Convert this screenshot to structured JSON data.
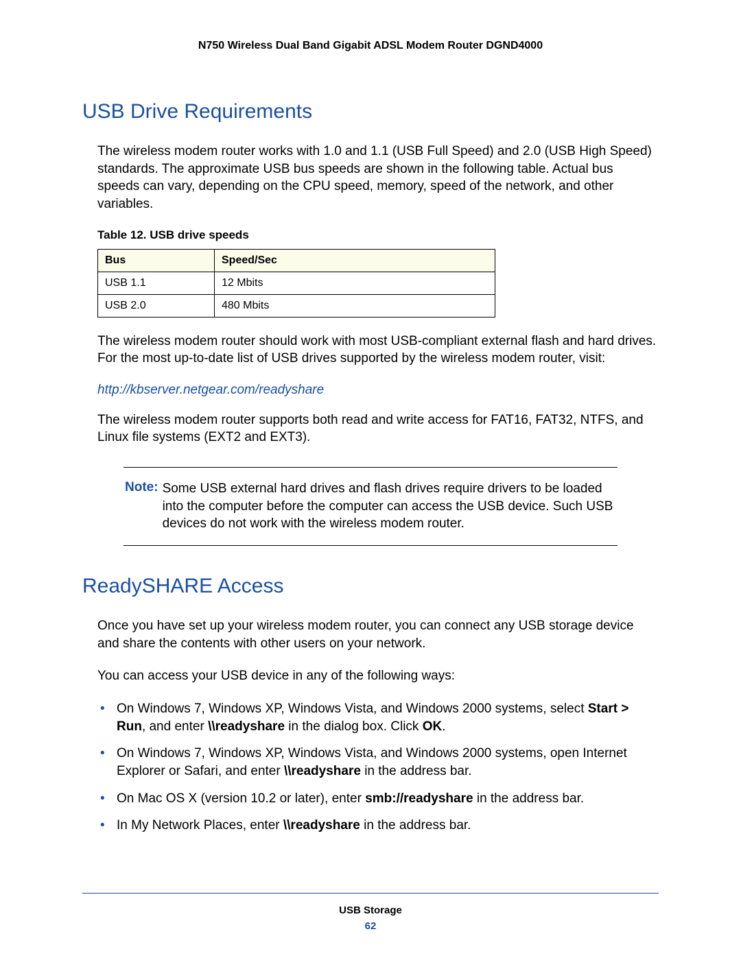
{
  "header": {
    "title": "N750 Wireless Dual Band Gigabit ADSL Modem Router DGND4000"
  },
  "section1": {
    "heading": "USB Drive Requirements",
    "para1": "The wireless modem router works with 1.0 and 1.1 (USB Full Speed) and 2.0 (USB High Speed) standards. The approximate USB bus speeds are shown in the following table. Actual bus speeds can vary, depending on the CPU speed, memory, speed of the network, and other variables.",
    "table_caption": "Table 12.  USB drive speeds",
    "table": {
      "headers": [
        "Bus",
        "Speed/Sec"
      ],
      "rows": [
        [
          "USB 1.1",
          "12 Mbits"
        ],
        [
          "USB 2.0",
          "480 Mbits"
        ]
      ]
    },
    "para2": "The wireless modem router should work with most USB-compliant external flash and hard drives. For the most up-to-date list of USB drives supported by the wireless modem router, visit:",
    "link": "http://kbserver.netgear.com/readyshare",
    "para3": "The wireless modem router supports both read and write access for FAT16, FAT32, NTFS, and Linux file systems (EXT2 and EXT3).",
    "note_label": "Note:",
    "note_text": "Some USB external hard drives and flash drives require drivers to be loaded into the computer before the computer can access the USB device. Such USB devices do not work with the wireless modem router."
  },
  "section2": {
    "heading": "ReadySHARE Access",
    "para1": "Once you have set up your wireless modem router, you can connect any USB storage device and share the contents with other users on your network.",
    "para2": "You can access your USB device in any of the following ways:",
    "items": {
      "i0": {
        "pre": "On Windows 7, Windows XP, Windows Vista, and Windows 2000 systems, select ",
        "b1": "Start > Run",
        "mid1": ", and enter ",
        "b2": "\\\\readyshare",
        "mid2": " in the dialog box. Click ",
        "b3": "OK",
        "post": "."
      },
      "i1": {
        "pre": "On Windows 7, Windows XP, Windows Vista, and Windows 2000 systems, open Internet Explorer or Safari, and enter ",
        "b1": "\\\\readyshare",
        "post": " in the address bar."
      },
      "i2": {
        "pre": "On Mac OS X (version 10.2 or later), enter ",
        "b1": "smb://readyshare",
        "post": " in the address bar."
      },
      "i3": {
        "pre": "In My Network Places, enter ",
        "b1": "\\\\readyshare",
        "post": " in the address bar."
      }
    }
  },
  "footer": {
    "title": "USB Storage",
    "page": "62"
  }
}
